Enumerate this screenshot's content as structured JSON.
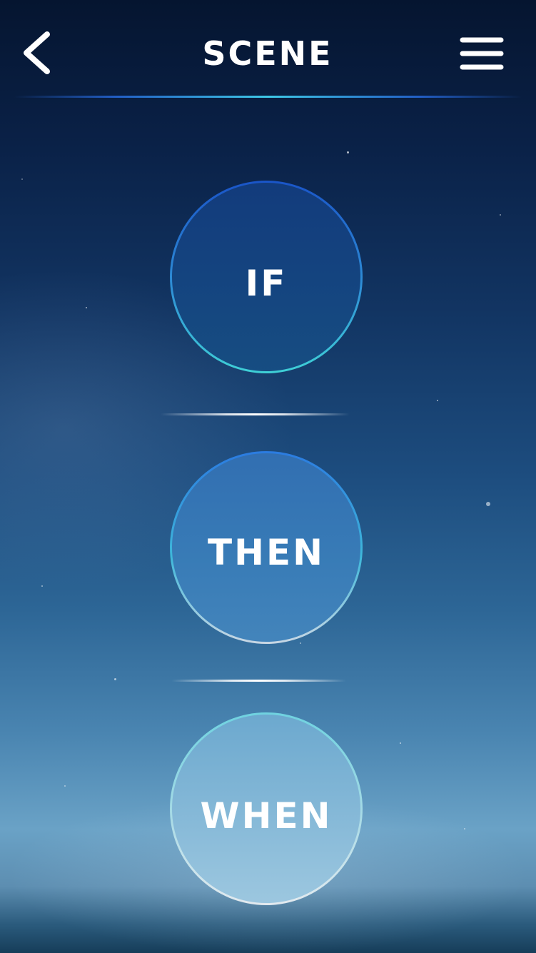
{
  "header": {
    "title": "SCENE",
    "back_icon": "chevron-left-icon",
    "menu_icon": "hamburger-menu-icon"
  },
  "scene": {
    "steps": [
      {
        "label": "IF"
      },
      {
        "label": "THEN"
      },
      {
        "label": "WHEN"
      }
    ]
  },
  "colors": {
    "accent_line": "#3ec8e6",
    "text": "#ffffff",
    "sky_top": "#051530",
    "sky_bottom": "#6aa2c6"
  }
}
